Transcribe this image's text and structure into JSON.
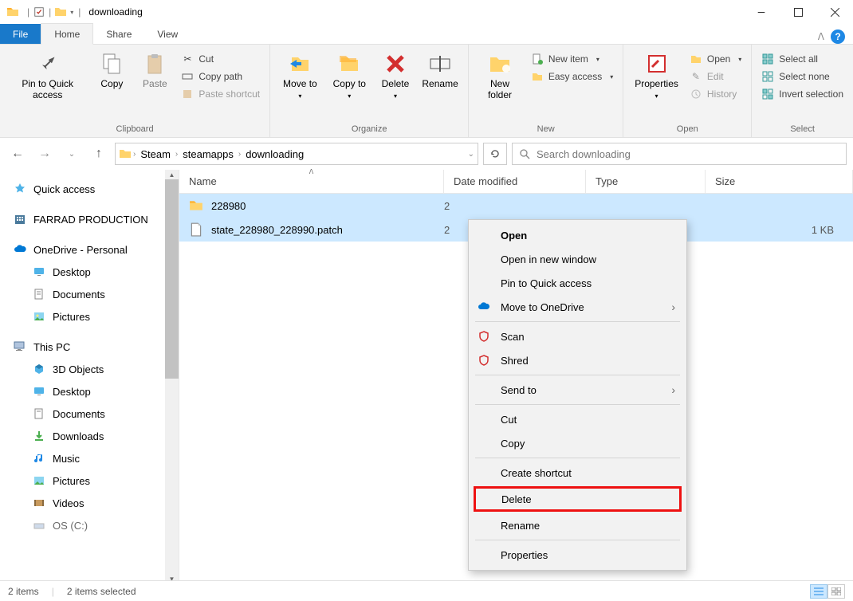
{
  "title": "downloading",
  "tabs": {
    "file": "File",
    "home": "Home",
    "share": "Share",
    "view": "View"
  },
  "ribbon": {
    "clipboard": {
      "label": "Clipboard",
      "pin": "Pin to Quick access",
      "copy": "Copy",
      "paste": "Paste",
      "cut": "Cut",
      "copypath": "Copy path",
      "pasteshortcut": "Paste shortcut"
    },
    "organize": {
      "label": "Organize",
      "moveto": "Move to",
      "copyto": "Copy to",
      "delete": "Delete",
      "rename": "Rename"
    },
    "new": {
      "label": "New",
      "newfolder": "New folder",
      "newitem": "New item",
      "easyaccess": "Easy access"
    },
    "open": {
      "label": "Open",
      "properties": "Properties",
      "open": "Open",
      "edit": "Edit",
      "history": "History"
    },
    "select": {
      "label": "Select",
      "selectall": "Select all",
      "selectnone": "Select none",
      "invert": "Invert selection"
    }
  },
  "breadcrumb": [
    "Steam",
    "steamapps",
    "downloading"
  ],
  "search_placeholder": "Search downloading",
  "columns": {
    "name": "Name",
    "date": "Date modified",
    "type": "Type",
    "size": "Size"
  },
  "files": [
    {
      "name": "228980",
      "date": "2",
      "type": "",
      "size": "",
      "icon": "folder"
    },
    {
      "name": "state_228980_228990.patch",
      "date": "2",
      "type": "",
      "size": "1 KB",
      "icon": "file"
    }
  ],
  "nav": {
    "quickaccess": "Quick access",
    "farrad": "FARRAD PRODUCTION",
    "onedrive": "OneDrive - Personal",
    "od_items": [
      "Desktop",
      "Documents",
      "Pictures"
    ],
    "thispc": "This PC",
    "pc_items": [
      "3D Objects",
      "Desktop",
      "Documents",
      "Downloads",
      "Music",
      "Pictures",
      "Videos",
      "OS (C:)"
    ]
  },
  "context_menu": {
    "open": "Open",
    "opennew": "Open in new window",
    "pinqa": "Pin to Quick access",
    "moveonedrive": "Move to OneDrive",
    "scan": "Scan",
    "shred": "Shred",
    "sendto": "Send to",
    "cut": "Cut",
    "copy": "Copy",
    "createshortcut": "Create shortcut",
    "delete": "Delete",
    "rename": "Rename",
    "properties": "Properties"
  },
  "status": {
    "items": "2 items",
    "selected": "2 items selected"
  }
}
